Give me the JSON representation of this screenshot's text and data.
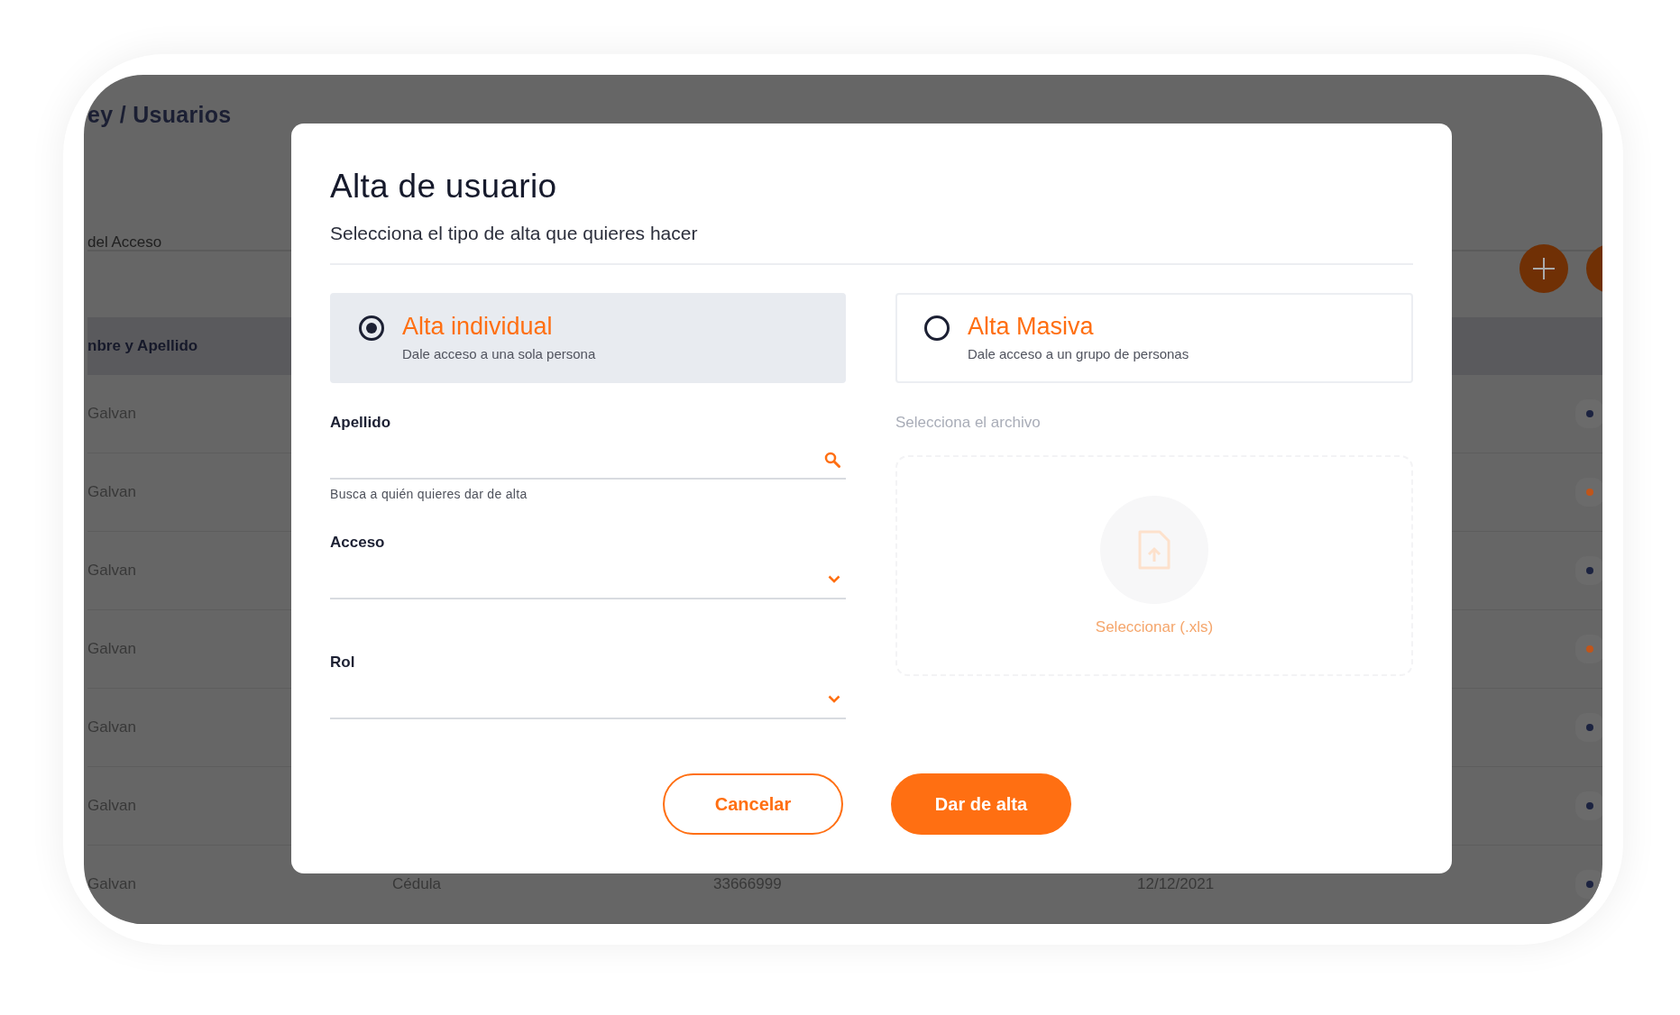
{
  "background": {
    "breadcrumb": "ey / Usuarios",
    "filter_label": "del Acceso",
    "table": {
      "header": "nbre y Apellido",
      "rows": [
        {
          "name": "Galvan",
          "color": "#1c2340"
        },
        {
          "name": "Galvan",
          "color": "#c0551a"
        },
        {
          "name": "Galvan",
          "color": "#1c2340"
        },
        {
          "name": "Galvan",
          "color": "#c0551a"
        },
        {
          "name": "Galvan",
          "color": "#1c2340"
        },
        {
          "name": "Galvan",
          "color": "#1c2340"
        },
        {
          "name": "Galvan",
          "color": "#1c2340",
          "document_type": "Cédula",
          "document_number": "33666999",
          "date": "12/12/2021"
        }
      ]
    }
  },
  "modal": {
    "title": "Alta de usuario",
    "subtitle": "Selecciona el tipo de alta que quieres hacer",
    "options": [
      {
        "title": "Alta individual",
        "description": "Dale acceso a una sola persona",
        "selected": true
      },
      {
        "title": "Alta Masiva",
        "description": "Dale acceso a un grupo de personas",
        "selected": false
      }
    ],
    "fields": [
      {
        "kind": "search",
        "label": "Apellido",
        "helper": "Busca a quién quieres dar de alta"
      },
      {
        "kind": "select",
        "label": "Acceso"
      },
      {
        "kind": "select",
        "label": "Rol"
      }
    ],
    "upload": {
      "label": "Selecciona el archivo",
      "button_label": "Seleccionar (.xls)",
      "disabled": true
    },
    "buttons": [
      {
        "label": "Cancelar",
        "kind": "secondary"
      },
      {
        "label": "Dar de alta",
        "kind": "primary"
      }
    ]
  }
}
